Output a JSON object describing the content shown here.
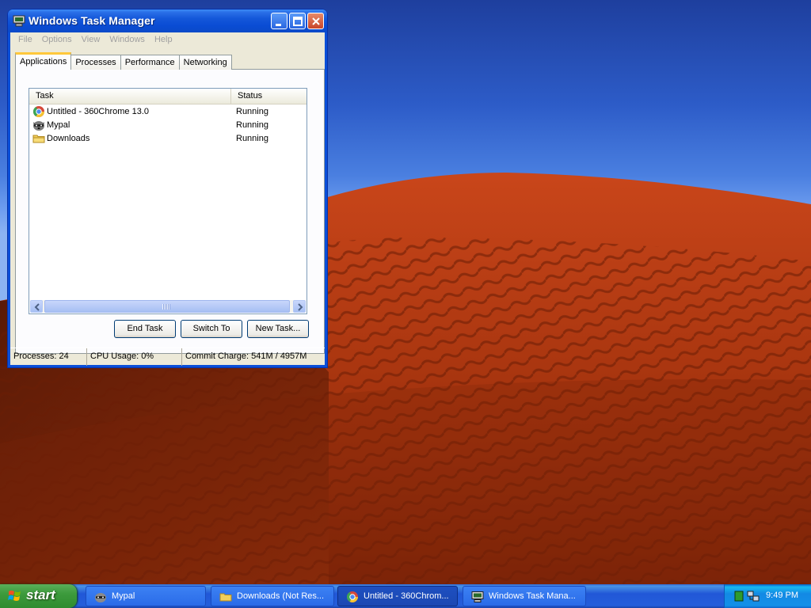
{
  "window": {
    "title": "Windows Task Manager",
    "menu": [
      "File",
      "Options",
      "View",
      "Windows",
      "Help"
    ],
    "tabs": [
      "Applications",
      "Processes",
      "Performance",
      "Networking"
    ],
    "active_tab": "Applications",
    "columns": {
      "task": "Task",
      "status": "Status"
    },
    "tasks": [
      {
        "name": "Untitled - 360Chrome 13.0",
        "status": "Running",
        "icon": "chrome-icon"
      },
      {
        "name": "Mypal",
        "status": "Running",
        "icon": "raccoon-icon"
      },
      {
        "name": "Downloads",
        "status": "Running",
        "icon": "folder-icon"
      }
    ],
    "buttons": {
      "end_task": "End Task",
      "switch_to": "Switch To",
      "new_task": "New Task..."
    },
    "status": {
      "processes": "Processes: 24",
      "cpu": "CPU Usage: 0%",
      "commit": "Commit Charge: 541M / 4957M"
    }
  },
  "taskbar": {
    "start_label": "start",
    "items": [
      {
        "label": "Mypal",
        "icon": "raccoon-icon"
      },
      {
        "label": "Downloads (Not Res...",
        "icon": "folder-icon"
      },
      {
        "label": "Untitled - 360Chrom...",
        "icon": "chrome-icon"
      },
      {
        "label": "Windows Task Mana...",
        "icon": "task-manager-icon"
      }
    ],
    "clock": "9:49 PM"
  },
  "colors": {
    "titlebar": "#0a4cd4",
    "taskbar": "#245edb",
    "start": "#3c9a3c",
    "dune": "#b83a14",
    "sky": "#2d5cc8"
  }
}
